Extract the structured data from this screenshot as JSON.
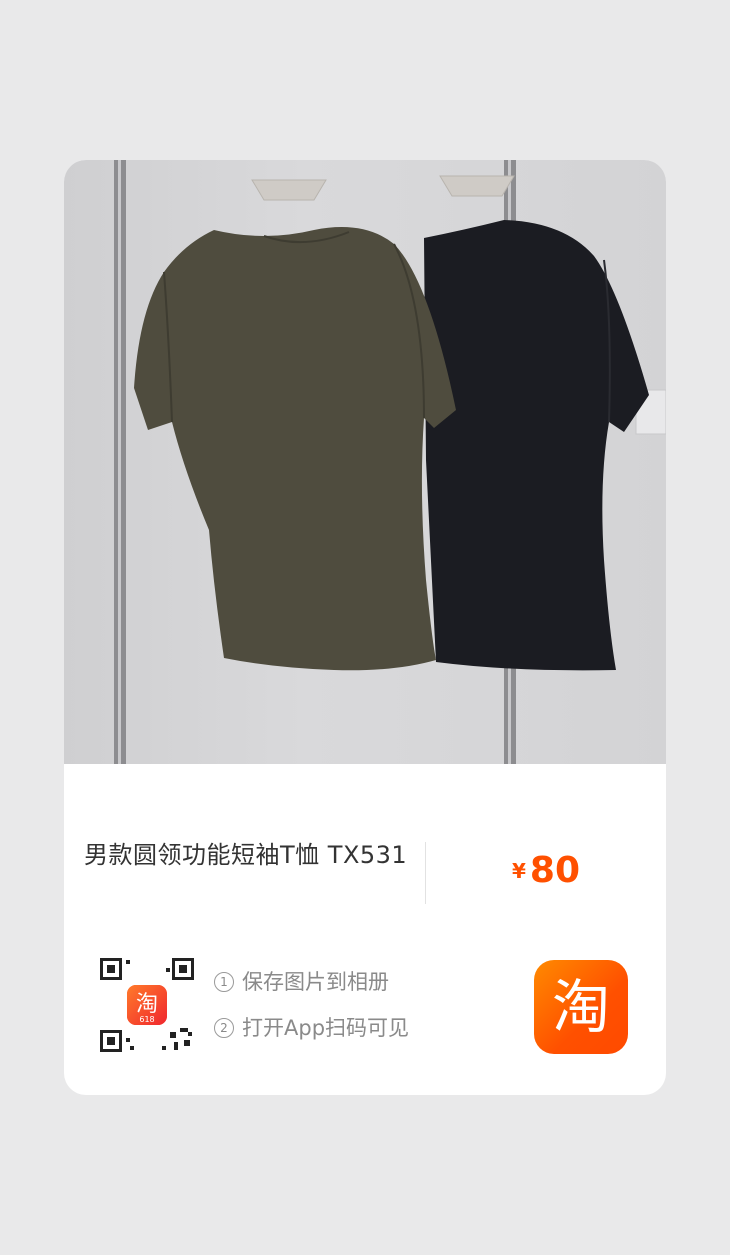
{
  "product": {
    "title": "男款圆领功能短袖T恤 TX531",
    "price_currency": "¥",
    "price_value": "80",
    "accent_color": "#ff5000"
  },
  "share": {
    "step1_index": "1",
    "step1_text": "保存图片到相册",
    "step2_index": "2",
    "step2_text": "打开App扫码可见",
    "qr_badge_text": "淘",
    "qr_badge_subtext": "618",
    "app_logo_text": "淘"
  },
  "icons": {
    "qr": "qr-code-icon",
    "logo": "taobao-logo-icon"
  }
}
